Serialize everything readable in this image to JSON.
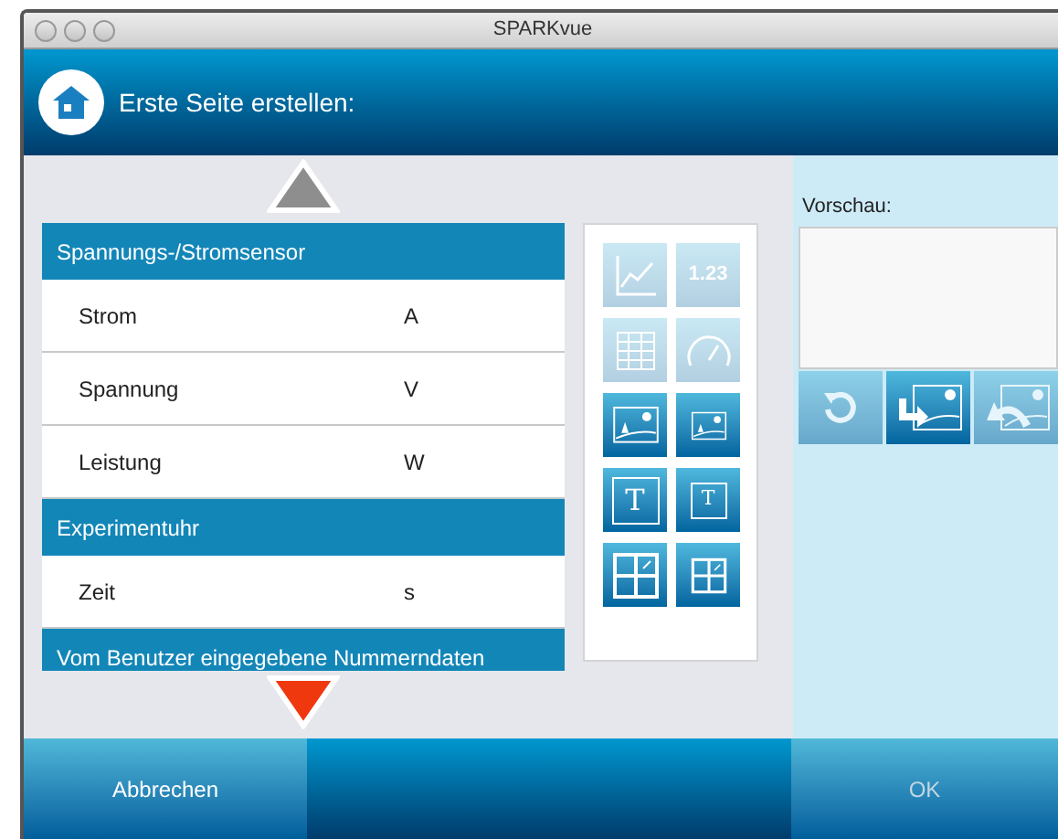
{
  "window": {
    "title": "SPARKvue"
  },
  "header": {
    "title": "Erste Seite erstellen:"
  },
  "scroll_up": {
    "disabled": true
  },
  "list": [
    {
      "kind": "group",
      "label": "Spannungs-/Stromsensor"
    },
    {
      "kind": "item",
      "label": "Strom",
      "unit": "A"
    },
    {
      "kind": "item",
      "label": "Spannung",
      "unit": "V"
    },
    {
      "kind": "item",
      "label": "Leistung",
      "unit": "W"
    },
    {
      "kind": "group",
      "label": "Experimentuhr"
    },
    {
      "kind": "item",
      "label": "Zeit",
      "unit": "s"
    },
    {
      "kind": "group",
      "label": "Vom Benutzer eingegebene Nummerndaten"
    }
  ],
  "scroll_down": {
    "disabled": false
  },
  "layouts": [
    {
      "kind": "graph",
      "disabled": true
    },
    {
      "kind": "digits",
      "label": "1.23",
      "disabled": true
    },
    {
      "kind": "table",
      "disabled": true
    },
    {
      "kind": "meter",
      "disabled": true
    },
    {
      "kind": "image-large",
      "disabled": false
    },
    {
      "kind": "image-small",
      "disabled": false
    },
    {
      "kind": "text-large",
      "label": "T",
      "disabled": false
    },
    {
      "kind": "text-small",
      "label": "T",
      "disabled": false
    },
    {
      "kind": "grid-large",
      "disabled": false
    },
    {
      "kind": "grid-small",
      "disabled": false
    }
  ],
  "preview": {
    "label": "Vorschau:",
    "buttons": [
      {
        "kind": "undo",
        "disabled": true
      },
      {
        "kind": "insert",
        "disabled": false
      },
      {
        "kind": "remove",
        "disabled": true
      }
    ]
  },
  "footer": {
    "cancel": {
      "label": "Abbrechen"
    },
    "ok": {
      "label": "OK",
      "disabled": true
    }
  }
}
